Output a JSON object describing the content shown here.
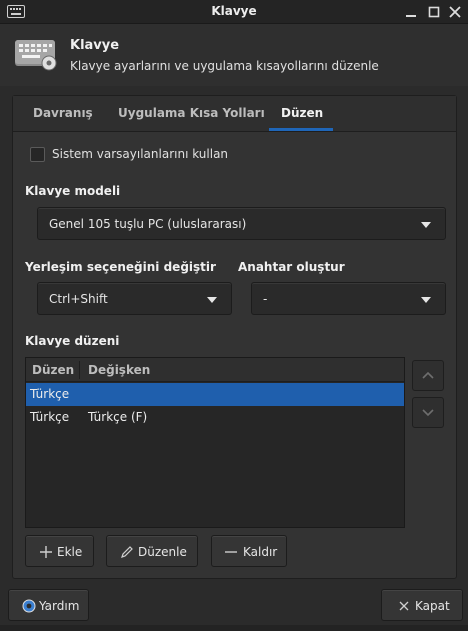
{
  "window": {
    "title": "Klavye"
  },
  "header": {
    "title": "Klavye",
    "subtitle": "Klavye ayarlarını ve uygulama kısayollarını düzenle",
    "icon": "keyboard-settings-icon"
  },
  "tabs": [
    {
      "label": "Davranış",
      "active": false
    },
    {
      "label": "Uygulama Kısa Yolları",
      "active": false
    },
    {
      "label": "Düzen",
      "active": true
    }
  ],
  "system_defaults": {
    "label": "Sistem varsayılanlarını kullan",
    "checked": false
  },
  "keyboard_model": {
    "label": "Klavye modeli",
    "selected": "Genel 105 tuşlu PC (uluslararası)"
  },
  "layout_switch": {
    "label": "Yerleşim seçeneğini değiştir",
    "selected": "Ctrl+Shift"
  },
  "compose_key": {
    "label": "Anahtar oluştur",
    "selected": "-"
  },
  "keyboard_layout": {
    "label": "Klavye düzeni",
    "columns": [
      "Düzen",
      "Değişken"
    ],
    "rows": [
      {
        "layout": "Türkçe",
        "variant": "",
        "selected": true
      },
      {
        "layout": "Türkçe",
        "variant": "Türkçe (F)",
        "selected": false
      }
    ]
  },
  "actions": {
    "add": "Ekle",
    "edit": "Düzenle",
    "remove": "Kaldır"
  },
  "footer": {
    "help": "Yardım",
    "close": "Kapat"
  },
  "colors": {
    "accent": "#1f5fad",
    "background": "#2b2b2b"
  }
}
